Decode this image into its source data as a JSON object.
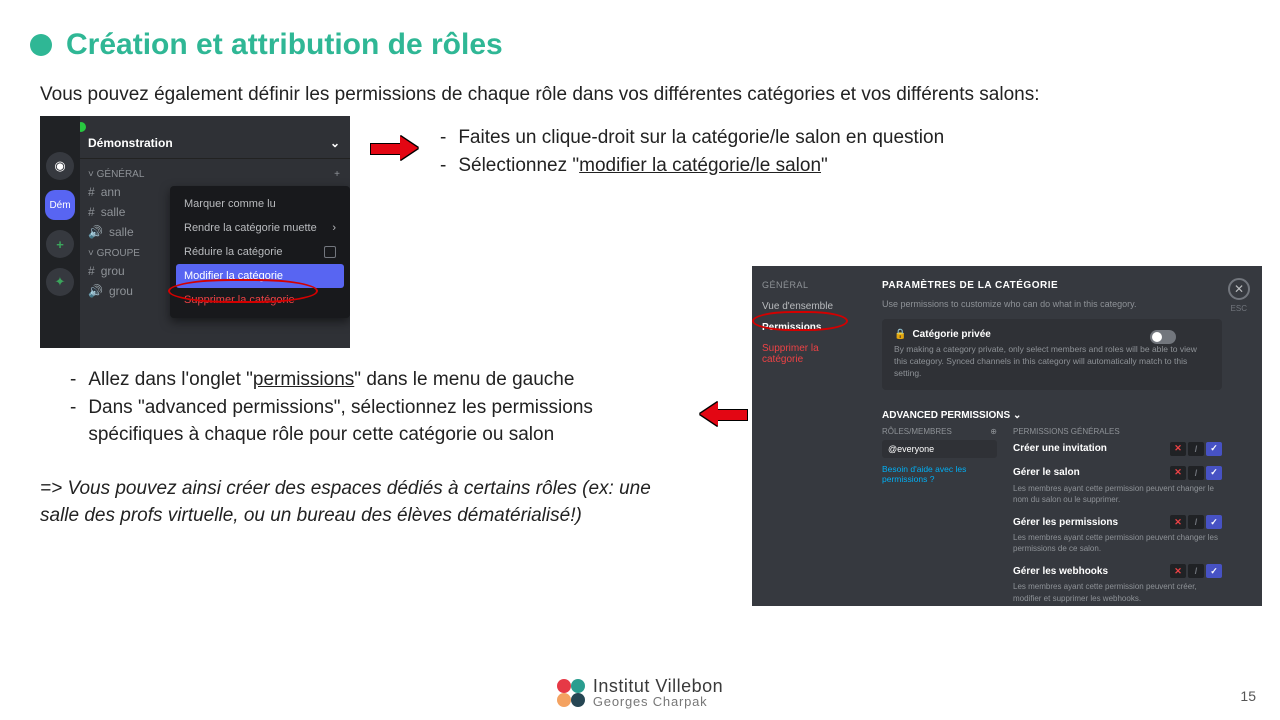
{
  "title": "Création et attribution de rôles",
  "intro": "Vous pouvez également définir les permissions de chaque rôle dans vos différentes catégories et vos différents salons:",
  "bullets1": {
    "a": "Faites un clique-droit sur la catégorie/le salon en question",
    "b_pre": "Sélectionnez \"",
    "b_u": "modifier la catégorie/le salon",
    "b_post": "\""
  },
  "bullets2": {
    "a_pre": "Allez dans l'onglet \"",
    "a_u": "permissions",
    "a_post": "\" dans le menu de gauche",
    "b": "Dans \"advanced permissions\", sélectionnez les permissions spécifiques à chaque rôle pour cette catégorie ou salon"
  },
  "conclusion": "=> Vous pouvez ainsi créer des espaces dédiés à certains rôles (ex: une salle des profs virtuelle, ou un bureau des élèves dématérialisé!)",
  "shot1": {
    "server": "Démonstration",
    "dem_badge": "Dém",
    "cat1": "GÉNÉRAL",
    "hash": "#",
    "ch_ann": "ann",
    "ch_salle": "salle",
    "ch_salle2": "salle",
    "cat2": "GROUPE",
    "ch_grou": "grou",
    "menu": {
      "m1": "Marquer comme lu",
      "m2": "Rendre la catégorie muette",
      "m3": "Réduire la catégorie",
      "m4": "Modifier la catégorie",
      "m5": "Supprimer la catégorie"
    }
  },
  "shot2": {
    "left_hdr": "GÉNÉRAL",
    "left1": "Vue d'ensemble",
    "left2": "Permissions",
    "left3": "Supprimer la catégorie",
    "title": "PARAMÈTRES DE LA CATÉGORIE",
    "desc": "Use permissions to customize who can do what in this category.",
    "priv_t": "Catégorie privée",
    "priv_d": "By making a category private, only select members and roles will be able to view this category. Synced channels in this category will automatically match to this setting.",
    "adv": "ADVANCED PERMISSIONS",
    "roles_hdr": "RÔLES/MEMBRES",
    "everyone": "@everyone",
    "help": "Besoin d'aide avec les permissions ?",
    "perms_hdr": "PERMISSIONS GÉNÉRALES",
    "p1_t": "Créer une invitation",
    "p2_t": "Gérer le salon",
    "p2_d": "Les membres ayant cette permission peuvent changer le nom du salon ou le supprimer.",
    "p3_t": "Gérer les permissions",
    "p3_d": "Les membres ayant cette permission peuvent changer les permissions de ce salon.",
    "p4_t": "Gérer les webhooks",
    "p4_d": "Les membres ayant cette permission peuvent créer, modifier et supprimer les webhooks.",
    "esc": "ESC",
    "lock": "🔒"
  },
  "footer": {
    "l1": "Institut Villebon",
    "l2": "Georges Charpak"
  },
  "page": "15"
}
